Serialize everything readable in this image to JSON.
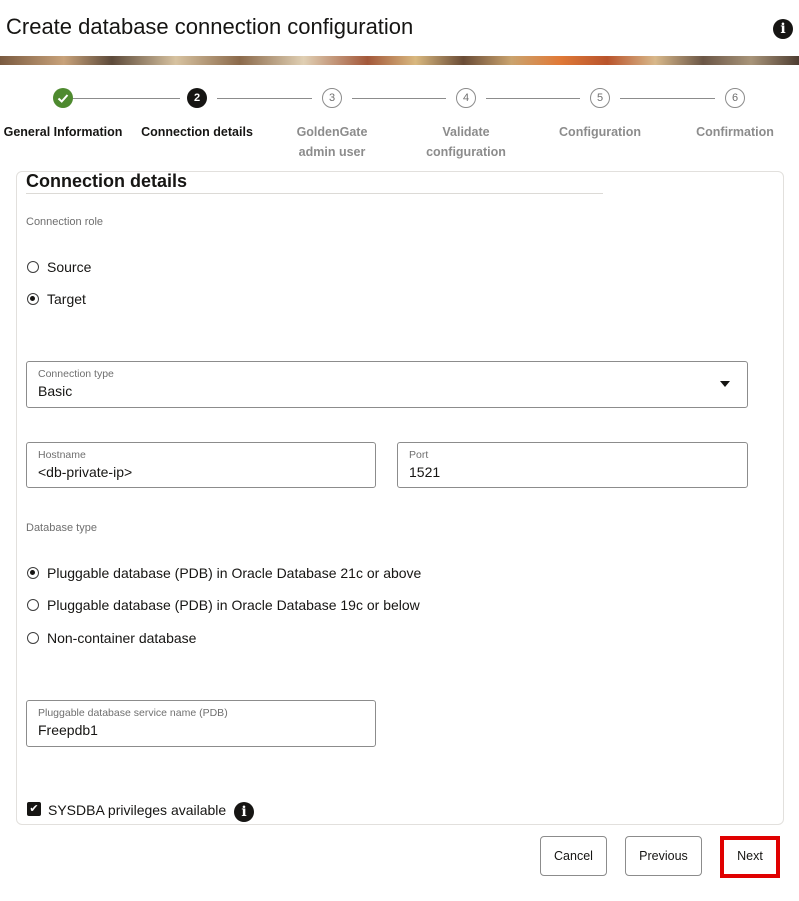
{
  "dialog": {
    "title": "Create database connection configuration",
    "info_icon": "info-icon"
  },
  "stepper": {
    "steps": [
      {
        "number": "1",
        "label": "General Information",
        "state": "completed"
      },
      {
        "number": "2",
        "label": "Connection details",
        "state": "current"
      },
      {
        "number": "3",
        "label": "GoldenGate admin user",
        "state": "todo"
      },
      {
        "number": "4",
        "label": "Validate configuration",
        "state": "todo"
      },
      {
        "number": "5",
        "label": "Configuration",
        "state": "todo"
      },
      {
        "number": "6",
        "label": "Confirmation",
        "state": "todo"
      }
    ],
    "completed_color": "#4e8a2f"
  },
  "section": {
    "title": "Connection details"
  },
  "connection_role": {
    "label": "Connection role",
    "options": [
      {
        "label": "Source",
        "selected": false
      },
      {
        "label": "Target",
        "selected": true
      }
    ]
  },
  "connection_type": {
    "label": "Connection type",
    "value": "Basic"
  },
  "hostname": {
    "label": "Hostname",
    "value": "<db-private-ip>"
  },
  "port": {
    "label": "Port",
    "value": "1521"
  },
  "database_type": {
    "label": "Database type",
    "options": [
      {
        "label": "Pluggable database (PDB) in Oracle Database 21c or above",
        "selected": true
      },
      {
        "label": "Pluggable database (PDB) in Oracle Database 19c or below",
        "selected": false
      },
      {
        "label": "Non-container database",
        "selected": false
      }
    ]
  },
  "pdb_service": {
    "label": "Pluggable database service name (PDB)",
    "value": "Freepdb1"
  },
  "sysdba": {
    "label": "SYSDBA privileges available",
    "checked": true
  },
  "footer": {
    "cancel_label": "Cancel",
    "previous_label": "Previous",
    "next_label": "Next",
    "highlight_color": "#e00000"
  }
}
